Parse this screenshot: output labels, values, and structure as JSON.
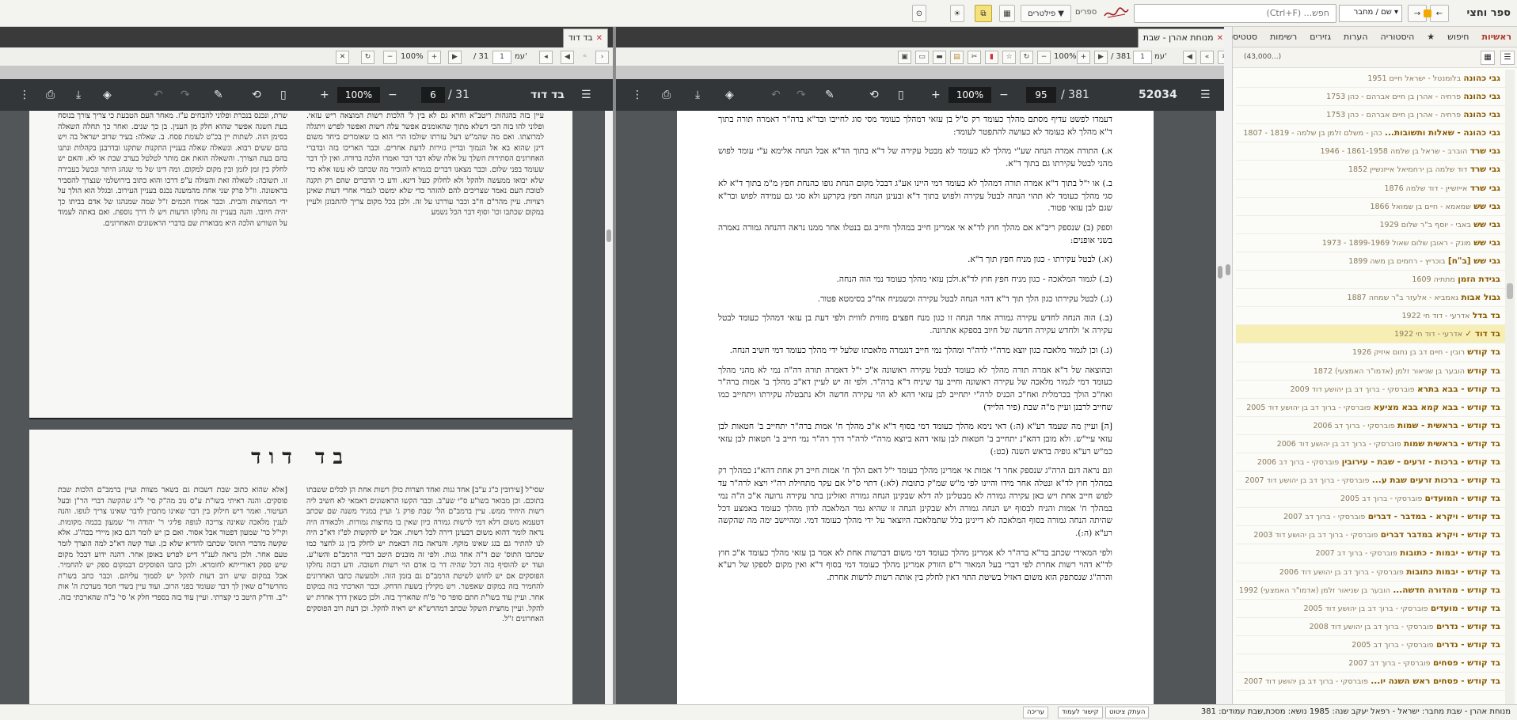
{
  "toolbar": {
    "app_title": "ספר וחצי",
    "back": "←",
    "forward": "→",
    "search_scope": "שם / מחבר",
    "search_placeholder": "חפש... (Ctrl+F)",
    "books_label": "ספרים",
    "filters": "פילטרים",
    "layout_icon": "▦",
    "split_icon": "⧉",
    "theme_icon": "☀",
    "settings_icon": "⊙"
  },
  "sidebar": {
    "tabs": [
      "ראשיות",
      "חיפוש",
      "★",
      "היסטוריה",
      "הערות",
      "גזירים",
      "רשימות",
      "סטטיסטיקה"
    ],
    "count": "(43,000...)",
    "books": [
      {
        "title": "גבי כהונה",
        "author": "בלומנטל - ישראל חיים 1951"
      },
      {
        "title": "גבי כהונה",
        "author": "פרחיה - אהרן בן חיים אברהם - כהן 1753"
      },
      {
        "title": "גבי כהונה",
        "author": "פרחיה - אהרן בן חיים אברהם - כהן 1753"
      },
      {
        "title": "גבי כהונה - שאלות ותשובות...",
        "author": "כהן - משלם זלמן בן שלמה - 1819 - 1807"
      },
      {
        "title": "גבי שרד",
        "author": "הוברב - שראל בן שלמה 1861-1958 - 1946"
      },
      {
        "title": "גבי שרד",
        "author": "דוד שלמה בן ירחמיאל אייזנשיין 1852"
      },
      {
        "title": "גבי שרד",
        "author": "אייזשיין - דוד שלמה 1876"
      },
      {
        "title": "גבי שש",
        "author": "שמאמא - חיים בן שמואל 1866"
      },
      {
        "title": "גבי שש",
        "author": "באבי - יוסף ב\"ר שלום 1929"
      },
      {
        "title": "גבי שש",
        "author": "מונק - ראובן שלום שאול 1899-1969 - 1973"
      },
      {
        "title": "גבי שש [ב\"ח]",
        "author": "בוכריץ - רחמים בן משה 1899"
      },
      {
        "title": "בגידת הזמן",
        "author": "מתתיה 1609"
      },
      {
        "title": "גבול אבות",
        "author": "גאמביא - אלעזר ב\"ר שמחה 1887"
      },
      {
        "title": "בד בדל",
        "author": "אדרעי - דוד חי 1922"
      },
      {
        "title": "בד דוד ✓",
        "author": "אדרעי - דוד חי 1922"
      },
      {
        "title": "בד קודש",
        "author": "רובין - חיים דב בן נחום איזיק 1926"
      },
      {
        "title": "בד קודש",
        "author": "הובער בן שניאור זלמן (אדמו\"ר האמצעי) 1872"
      },
      {
        "title": "בד קודש - בבא בתרא",
        "author": "פוברסקי - ברוך דב בן יהושע דוד 2009"
      },
      {
        "title": "בד קודש - בבא קמא בבא מציעא",
        "author": "פוברסקי - ברוך דב בן יהושע דוד 2005"
      },
      {
        "title": "בד קודש - בראשית - שמות",
        "author": "פוברסקי - ברוך דב 2006"
      },
      {
        "title": "בד קודש - בראשית שמות",
        "author": "פוברסקי - ברוך דב בן יהושע דוד 2006"
      },
      {
        "title": "בד קודש - ברכות - זרעים - שבת - עירובין",
        "author": "פוברסקי - ברוך דב 2006"
      },
      {
        "title": "בד קודש - ברכות זרעים שבת ע...",
        "author": "פוברסקי - ברוך דב בן יהושע דוד 2007"
      },
      {
        "title": "בד קודש - המועדים",
        "author": "פוברסקי - ברוך דב 2005"
      },
      {
        "title": "בד קודש - ויקרא - במדבר - דברים",
        "author": "פוברסקי - ברוך דב 2007"
      },
      {
        "title": "בד קודש - ויקרא במדבר דברים",
        "author": "פוברסקי - ברוך דב בן יהושע דוד 2003"
      },
      {
        "title": "בד קודש - יבמות - כתובות",
        "author": "פוברסקי - ברוך דב 2007"
      },
      {
        "title": "בד קודש - יבמות כתובות",
        "author": "פוברסקי - ברוך דב בן יהושע דוד 2006"
      },
      {
        "title": "בד קודש - מהדורה חדשה...",
        "author": "הובער בן שניאור זלמן (אדמו\"ר האמצעי) 1992"
      },
      {
        "title": "בד קודש - מועדים",
        "author": "פוברסקי - ברוך דב בן יהושע דוד 2005"
      },
      {
        "title": "בד קודש - נדרים",
        "author": "פוברסקי - ברוך דב בן יהושע דוד 2008"
      },
      {
        "title": "בד קודש - נדרים",
        "author": "פוברסקי - ברוך דב 2005"
      },
      {
        "title": "בד קודש - פסחים",
        "author": "פוברסקי - ברוך דב 2007"
      },
      {
        "title": "בד קודש - פסחים ראש השנה יו...",
        "author": "פוברסקי - ברוך דב בן יהושע דוד 2007"
      }
    ]
  },
  "right_pane": {
    "tab_label": "מנוחת אהרן - שבת",
    "nav": {
      "page_label": "עמ'",
      "page": "1",
      "total": "/ 381",
      "zoom": "100%"
    },
    "pdf": {
      "doc_id": "52034",
      "page": "95",
      "total": "/ 381",
      "zoom": "100%"
    },
    "paragraphs": [
      "דעמדו לפשט עדיף מסתם מהלך כעומד רק ס\"ל בן עזאי דמהלך כעומד מסי סוג לחייבו ובד\"א ברה\"ר דאמרה תורה בתוך ד\"א מהלך לא כעומד לא כעושה להתפטר לעומד:",
      "א.) התורה אמרה הנחה שע\"י מהלך לא כעומד לא מבטל עקירה של ד\"א בתוך הד\"א אבל הנחה אלימא ע\"י עומד לפוש מהני לבטל עקירתו גם בתוך ד\"א.",
      "ב.) או י\"ל בתוך ד\"א אמרה תורה דמהלך לא כעומד דמי היינו אע\"ג דבכל מקום הנחת גופו כהנחת חפץ מ\"מ בתוך ד\"א לא סגי מהלך כעומד לא תהוי הנחה לבטל עקירה ולפוש בתוך ד\"א ובעינן הנחה חפץ בקרקע ולא סגי גם עמידה לפוש ובר\"א שגם לבן עזאי פטור.",
      "וספק (ב) שנספק ריב\"א אם מהלך חוץ לד\"א אי אמרינן חייב במהלך וחייב גם בנטלו אחר ממנו נראה דהנחה גמורה נאמרה בשני אופנים:",
      "(א.) לבטל עקירתו - כגון מניח חפץ תוך ד\"א.",
      "(ב.) לגמור המלאכה - כגון מניח חפץ חוץ לד\"א.ולכן עזאי מהלך כעומד נמי הוה הנחה.",
      "(ג.) לבטל עקירתו כגון הלך תוך ד\"א דהוי הנחה לבטל עקירה וכשמניח אח\"כ בסימטא פטור.",
      "(ב.) הוה הנחה לחדש עקירה גמורה אחר הנחה זו כגון מנח חפצים מזווית לזווית ולפי דעת בן עזאי דמהלך כעומד לבטל עקירה א' ולחדש עקירה חדשה של חיוב בספקא אתרונה.",
      "(ג.) וכן לגמור מלאכה כגון יוצא מרה\"י לרה\"ר ומהלך נמי חייב דנגמרה מלאכתו שלעל ידי מהלך כעומד דמי חשיב הנחה.",
      "ובהוצאה של ד\"א אמרה תורה מהלך לא כעומד לבטל עקירה ראשונה א\"כ י\"ל דאמרה תורה דה\"ה נמי לא מהני מהלך כעומד דמי לגמור מלאכה של עקירה ראשונה וחייב עד שיניח ד\"א ברה\"ר. ולפי זה יש לעיין דא\"כ מהלך ב' אמות ברה\"ר ואח\"כ הולך בכרמלית ואח\"כ הכניס לרה\"י יתחייב לבן עזאי דהא לא הוי עקירה חדשה ולא נתבטלה עקירתו ויתחייב כמו שחייב לרבנן ועיין מ\"ה שבת (פיר הלייד)",
      "[ה] ועיין מה שעמד רע\"א (ה:) דאי נימא מהלך כעומד דמי בסוף ד\"א א\"כ מהלך ח' אמות ברה\"ר יתחייב ב' חטאות לבן עזאי עיי\"ש. ולא מובן דהא\"נ יתחייב ב' חטאות לבן עזאי דהא ביוצא מרה\"י לרה\"ר דרך רה\"ר נמי חייב ב' חטאות לבן עזאי כמ\"ש רע\"א גופיה בראש השנה (כט:)",
      "וגם נראה דגם הרה\"ג שנספק אחר ד' אמות אי אמרינן מהלך כעומד י\"ל דאם הלך ח' אמות חייב רק אחת דהא\"נ כמהלך רק במהלך חוץ לד\"א ונטלה אחר מידו והיינו לפי מ\"ש שמ\"ק כתובות (לא:) דתוי ס\"ל אם עקר מתחילת רה\"י ויצא לרה\"ר עד לפוש חייב אחת ויש כאן עקירה גמורה לא מבטלינן לה דלא שבקינן הנחה גמורה ואזלינן בתר עקירה גרועה א\"כ ה\"ה נמי במהלך ח' אמות והניח לבסוף יש הנחה גמורה ולא שבקינן הנחה זו שהיא גמר המלאכה לדון מהלך כעומד באמצע דכל שהיתה הנחה גמורה בסוף המלאכה לא דיינינן בלל שתמלאכה היוצאר על ידי מהלך כעומד דמי. ומהיישב ימה מה שהקשה רע\"א (ה:).",
      "ולפי המאירי שכתב בד\"א ברה\"ר לא אמרינן מהלך כעומד דמי משום דברשות אחת לא אמר בן עזאי מהלך כעומד א\"כ חוץ לד\"א דהוי רשות אחרת לפי דברי בעל המאור ר\"פ הזורק אמרינן מהלך כעומד דמי בסוף ד\"א ואין מקום לספקו של רע\"א והרה\"ג שנסתפק הוא משום דאזיל בשיטת התוי דאין לחלק בין אותה רשות לרשות אחרת."
    ]
  },
  "left_pane": {
    "tab_label": "בד דוד",
    "nav": {
      "page_label": "עמ'",
      "page": "1",
      "total": "/ 31",
      "zoom": "100%"
    },
    "pdf": {
      "title": "בד דוד",
      "page": "6",
      "total": "/ 31",
      "zoom": "100%"
    },
    "scan_page_1": {
      "col_right": "עיין בזה בהגהות ריטב\"א וחרא גם לא בין ל' הלכות רשות המוצאה ריש עזאי. ופלוני להו בזה הכי דשלא מתוך שהאומנים אפשר עלה רשות ואפשר לפרש ויתגלה למרוצתו. ואם מה שהמ\"ש דעל עזרתו שולמו הרי הוא בו שאומרים ביחד משום דינן שהוא בא אל הנמוך ובדיין גזירות לדעת אחרים. וכבר האריכו בזה ובדברי האחרונים הסתירות השלך על אלה שלא דבר דבר ואמרו הלכה ברורה. ואין לך דבר שעומד בפני שלום. וכבר מצאנו דברים בגמרא להזכיר מה שכתבו לא עשו אלא כדי שלא יבואו ממעשה ולהקל ולא לחלוק כעל דינא. ודע כי הדברים שהם רק תקנה לטובת העם נאמר שצריכים להם להזהר כדי שלא ימשכו לגמרי אחרי דעות שאינן רצויות. עיין מהר\"ם ח\"ב וכבר עוררנו על זה. ולכן בכל מקום צריך להתבונן ולעיין במקום שכתבו וכו' וסוף דבר הכל נשמע",
      "col_left": "שרת, ונכנס בנכרת ופלוני להבחים ע\"ז. מאחר העם הטבעת כי צריך צורך בנוסח בעת השגה אפשר שהוא חלק מן הענין. בן כך שנים. ואחר כך תחלה השאלה בסימן הזה. לשתות יין בכ\"ט לעומת פסח. ב. שאלה: בעיר שרוב ישראל בה ויש בהם ששים רבוא. ונשאלה שאלה בעניין התקנות שתקנו ובדרבנן בקהלות ונתנו בהם בעת הצורך. והשאלה הזאת אם מותר לטלטל בערב שבת או לא. והאם יש לחלק בין זמן לזמן ובין מקום למקום. ומה דינו של מי שנהג היתר ונכשל בעבירה זו. תשובה: לשאלה זאת והעולה ע\"פ דרכו והוא כתוב בירושלמי שנצרך להסביר בראשונה. וו\"ל פרק שני אחת מהמשנה נכנס בעניין העירוב. ובגלל הוא הולך על ידי המחיצות והבית. וכבר אמרו חכמים ז\"ל שמה שמנהגו של אדם בביתו כך יהיה חיובו. והנה בעניין זה נחלקו הדעות ויש לו דרך נוספת. ואם באתה לעמוד על השורש הלכה היא מבוארת שם בדברי הראשונים והאחרונים."
    },
    "scan_page_2": {
      "heading": "בד דוד",
      "col_right": "שסי\"ל [עירובין כ\"ג ע\"ב] אחד גגות ואחד חצרות כולן רשות אחת הן לכלים ששבתו בתוכם. וכן מבואר בשו\"ע ס\"י שע\"ב. וכבר הקשו הראשונים דאמאי לא חשיב ליה רשות היחיד ממש. עיין ברמב\"ם הל' שבת פרק ג' ועיין במגיד משנה שם שכתב דטעמא משום דלא דמי לרשות גמורה כיון שאין בו מחיצות גמורות. ולכאורה היה נראה לומר דהוא משום דבעינן דירה לכל רשות. אבל יש להקשות לפ\"ז דא\"כ היה לנו להתיר גם בגג שאינו מוקף. והנראה בזה דבאמת יש לחלק בין גג לחצר כמו שכתבו התוס' שם ד\"ה אחד גגות. ולפי זה מובנים היטב דברי הרמב\"ם והשו\"ע. ועוד יש להוסיף בזה דכל שהיה דר בו אדם הוי רשות חשובה. ודע דבזה נחלקו הפוסקים אם יש לחוש לשיטת הרמב\"ם גם בזמן הזה. ולמעשה כתבו האחרונים להחמיר בזה במקום שאפשר. ויש מקילין בשעת הדחק. וכבר הארכתי בזה במקום אחר. ועיין עוד בשו\"ת חתם סופר סי' פ\"ח שהאריך בזה. ולכן כשאין דרך אחרת יש להקל. ועיין מחצית השקל שכתב דמהרש\"א יש ראיה להקל. וכן דעת רוב הפוסקים האחרונים ז\"ל.",
      "col_left": "[אלא שהוא כתוב שבת דשבות גם בשאר מצוות ועיין ברמב\"ם הלכות שבת פוסקים. והנה ראיתי בשו\"ת ע\"ס נוב מה\"ק סי' ל\"ג שהקשה דברי הר\"ן ובעל העיטור. ואמר דיש חילוק בין דבר שאינו מתכוין לדבר שאינו צריך לגופו. והנה לענין מלאכה שאינה צריכה לגופה פליגי ר' יהודה ור' שמעון בכמה מקומות. וקי\"ל כר' שמעון דפטור אבל אסור. ואם כן יש לומר דגם כאן מיירי בכה\"ג. אלא שקשה מדברי התוס' שכתבו להדיא שלא כן. ועוד קשה דא\"כ למה הוצרך לומר טעם אחר. ולכן נראה לענ\"ד דיש לפרש באופן אחר. דהנה ידוע דבכל מקום שיש ספק דאורייתא לחומרא. ולכן כתבו הפוסקים דבמקום ספק יש להחמיר. אבל במקום שיש רוב דעות להקל יש לסמוך עליהם. וכבר כתב בשו\"ת מהרשד\"ם שאין לך דבר שעומד בפני הרוב. ועוד עיין בשדי חמד מערכת ה' אות י\"ב. ודו\"ק היטב כי קצרתי. ועיין עוד בזה בספרי חלק א' סי' כ\"ה שהארכתי בזה."
    }
  },
  "statusbar": {
    "text": "מנוחת אהרן - שבת   מחבר: ישראל - רפאל יעקב   שנה: 1985   נושא: מסכת,שבת   עמודים: 381",
    "btn1": "העתק ציטוט",
    "btn2": "קישור לעמוד",
    "btn3": "עריכה"
  },
  "colors": {
    "accent": "#b03b2f",
    "selected_row": "#f7eeb4",
    "pdf_toolbar": "#323639",
    "pdf_viewer_bg": "#525659"
  }
}
